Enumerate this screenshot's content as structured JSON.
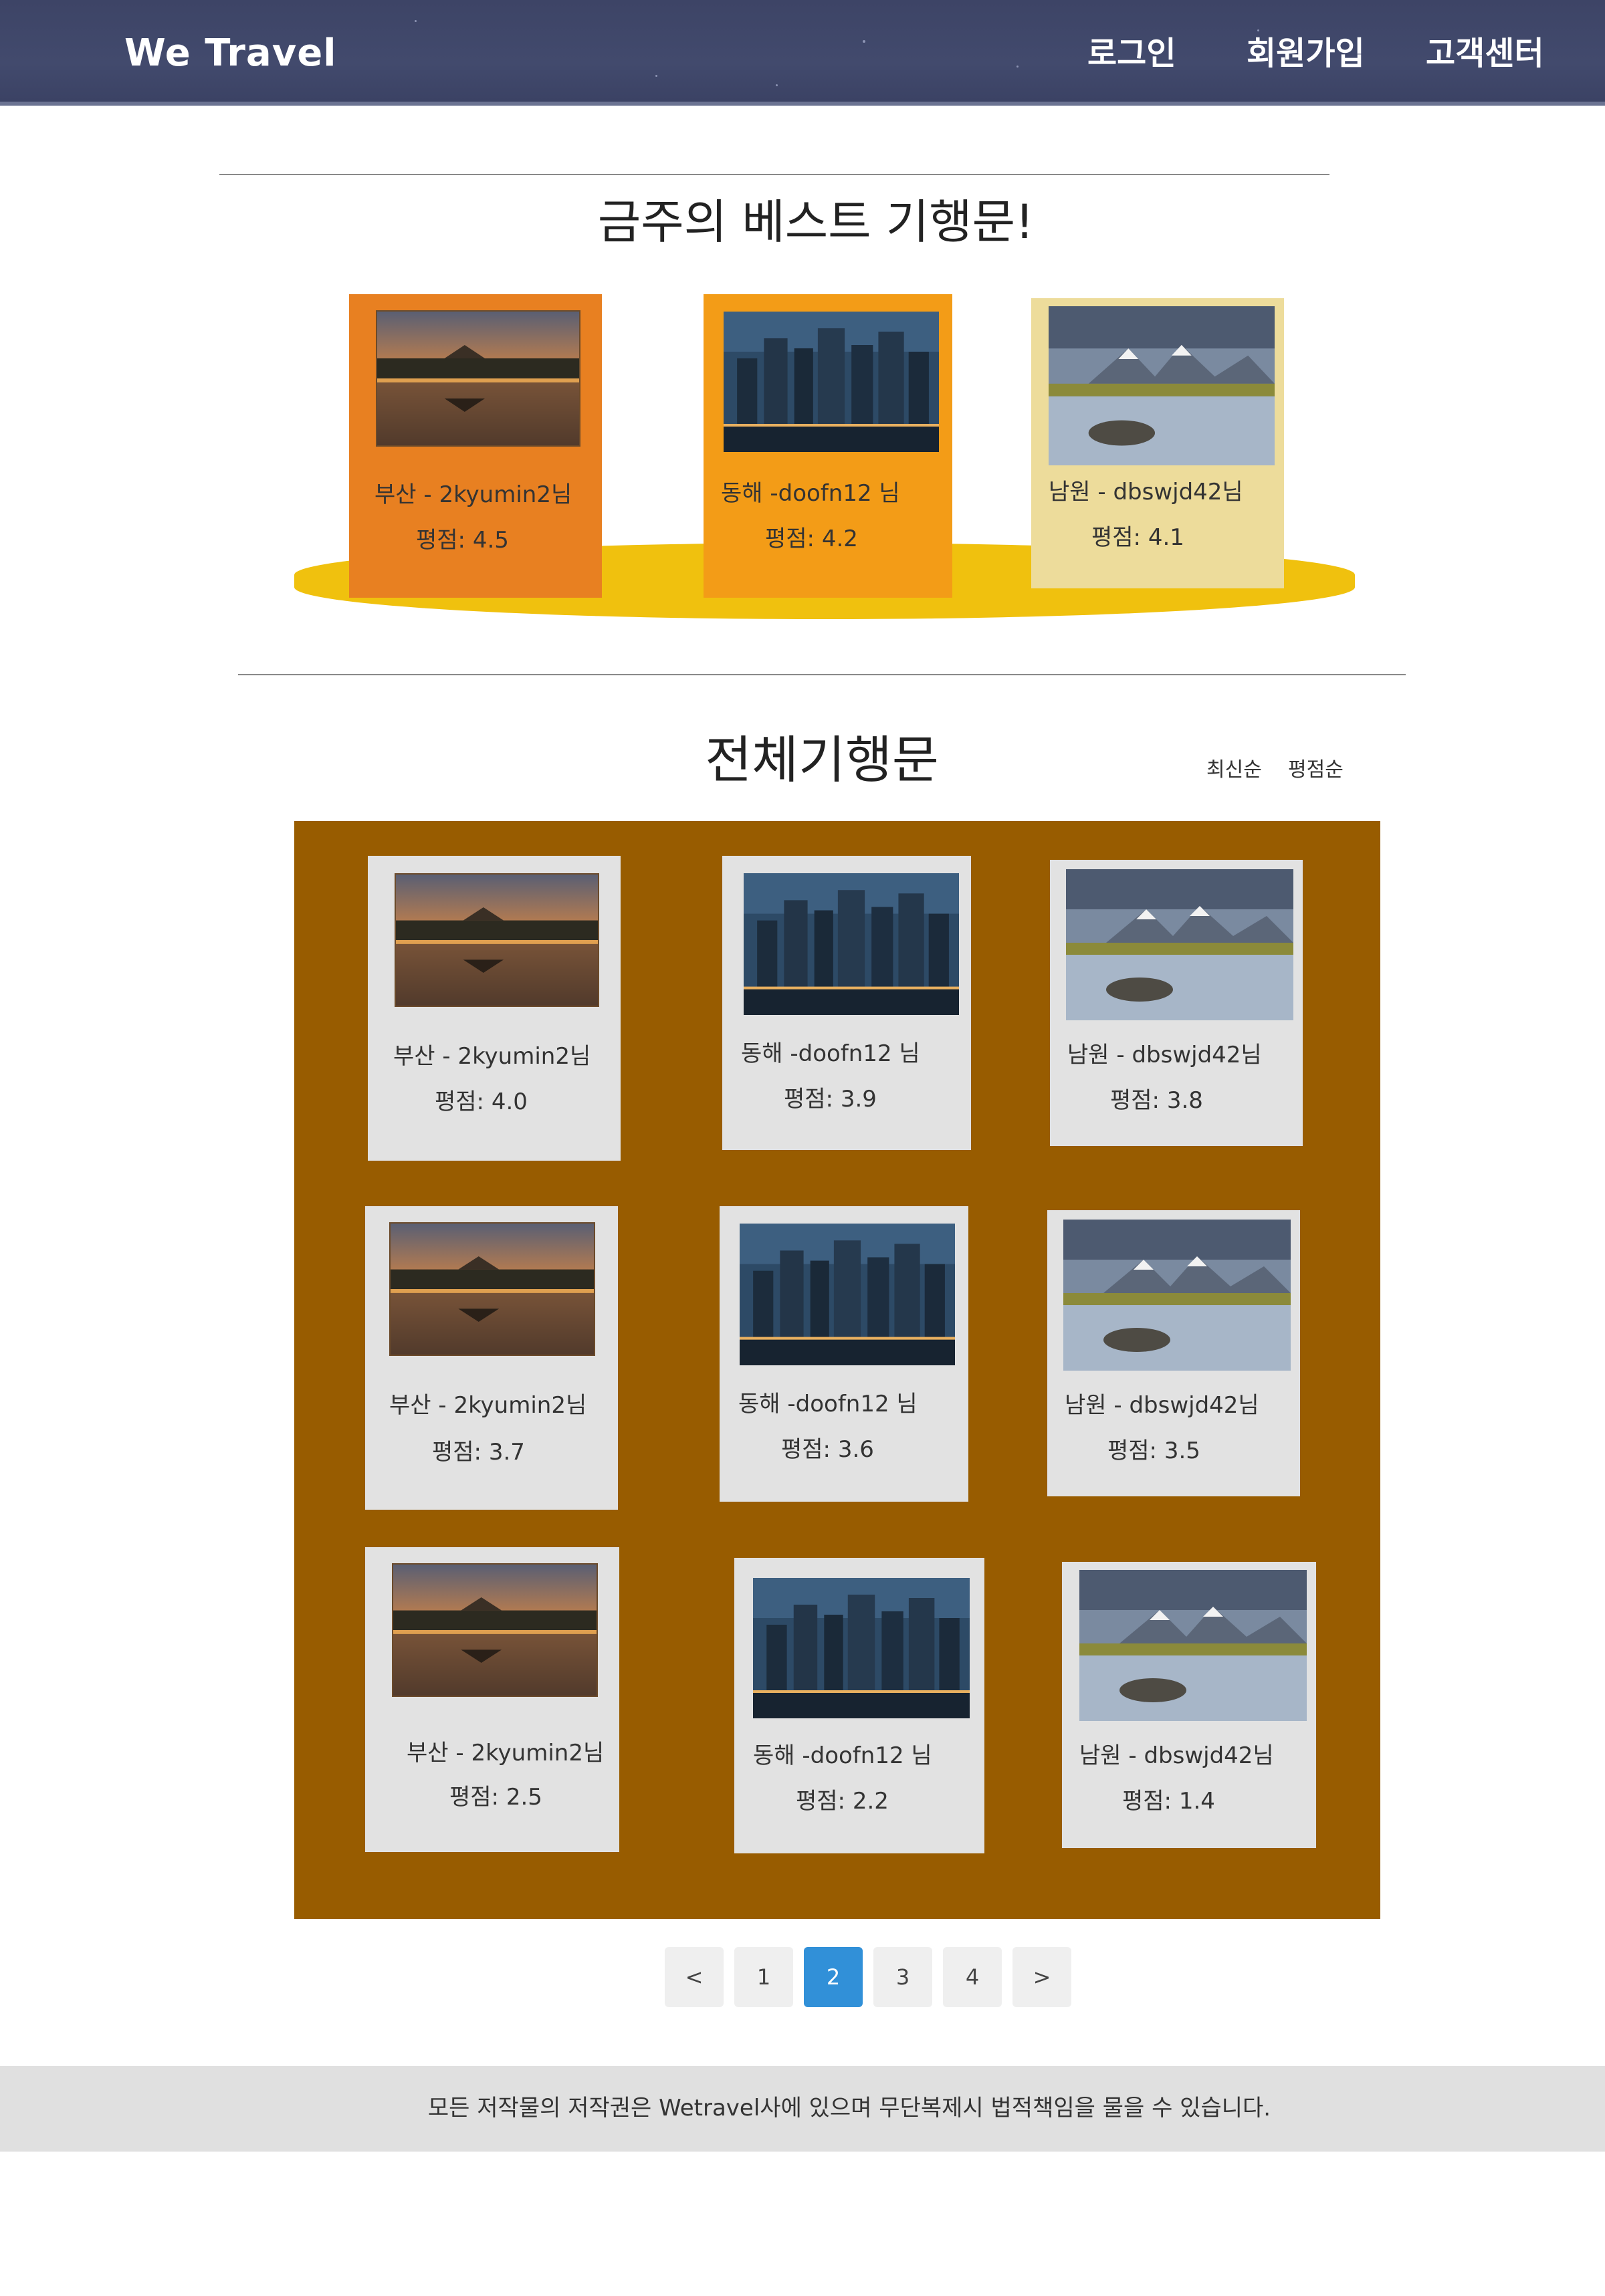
{
  "header": {
    "logo": "We Travel",
    "nav": [
      {
        "label": "로그인"
      },
      {
        "label": "회원가입"
      },
      {
        "label": "고객센터"
      }
    ]
  },
  "best": {
    "title": "금주의 베스트 기행문!",
    "cards": [
      {
        "name": "부산 - 2kyumin2님",
        "score": "평점: 4.5",
        "image": "palace-sunset",
        "color": "#e88021"
      },
      {
        "name": "동해 -doofn12 님",
        "score": "평점: 4.2",
        "image": "city-night",
        "color": "#f39c17"
      },
      {
        "name": "남원 - dbswjd42님",
        "score": "평점: 4.1",
        "image": "mountain-lake",
        "color": "#eddc9b"
      }
    ]
  },
  "all": {
    "title": "전체기행문",
    "sort": [
      "최신순",
      "평점순"
    ],
    "cards": [
      {
        "name": "부산 - 2kyumin2님",
        "score": "평점: 4.0",
        "image": "palace-sunset"
      },
      {
        "name": "동해 -doofn12 님",
        "score": "평점: 3.9",
        "image": "city-night"
      },
      {
        "name": "남원 - dbswjd42님",
        "score": "평점: 3.8",
        "image": "mountain-lake"
      },
      {
        "name": "부산 - 2kyumin2님",
        "score": "평점: 3.7",
        "image": "palace-sunset"
      },
      {
        "name": "동해 -doofn12 님",
        "score": "평점: 3.6",
        "image": "city-night"
      },
      {
        "name": "남원 - dbswjd42님",
        "score": "평점: 3.5",
        "image": "mountain-lake"
      },
      {
        "name": "부산 - 2kyumin2님",
        "score": "평점: 2.5",
        "image": "palace-sunset"
      },
      {
        "name": "동해 -doofn12 님",
        "score": "평점: 2.2",
        "image": "city-night"
      },
      {
        "name": "남원 - dbswjd42님",
        "score": "평점: 1.4",
        "image": "mountain-lake"
      }
    ]
  },
  "pagination": {
    "prev": "<",
    "pages": [
      "1",
      "2",
      "3",
      "4"
    ],
    "current": "2",
    "next": ">"
  },
  "footer": {
    "text": "모든 저작물의 저작권은 Wetravel사에 있으며 무단복제시 법적책임을 물을 수 있습니다."
  },
  "colors": {
    "header": "#3f4668",
    "podium": "#f0c10e",
    "grid_background": "#985c00",
    "card_background": "#e2e2e2",
    "active_page": "#3190d8"
  }
}
